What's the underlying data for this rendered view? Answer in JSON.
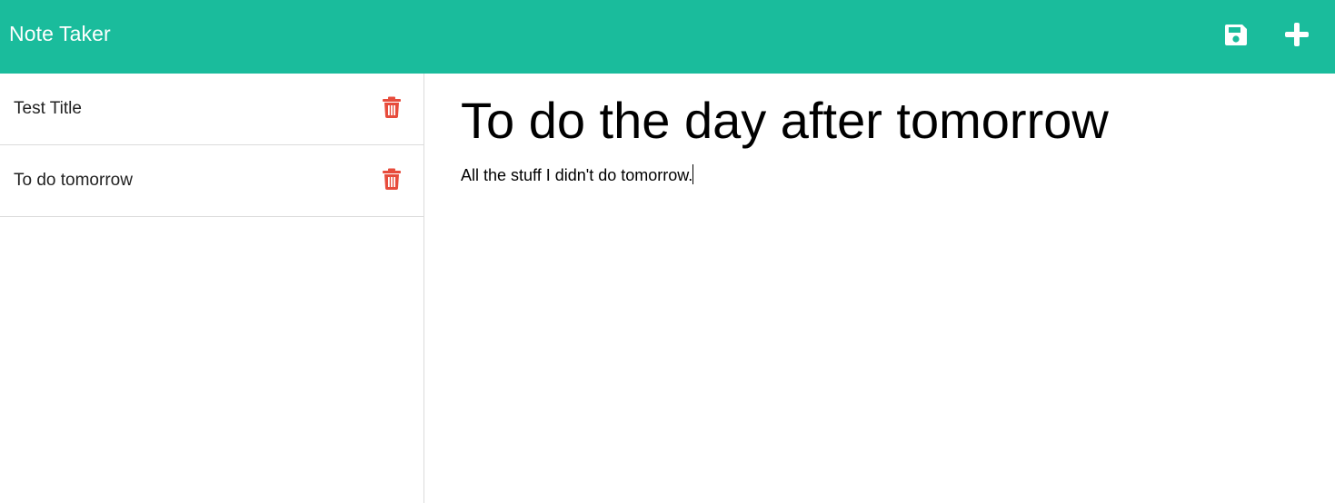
{
  "header": {
    "app_title": "Note Taker",
    "save_icon": "floppy-disk-icon",
    "new_icon": "plus-icon",
    "background_color": "#1abc9c"
  },
  "sidebar": {
    "notes": [
      {
        "title": "Test Title",
        "delete_icon": "trash-icon"
      },
      {
        "title": "To do tomorrow",
        "delete_icon": "trash-icon"
      }
    ],
    "delete_icon_color": "#e74c3c"
  },
  "editor": {
    "title_value": "To do the day after tomorrow",
    "text_value": "All the stuff I didn't do tomorrow."
  }
}
